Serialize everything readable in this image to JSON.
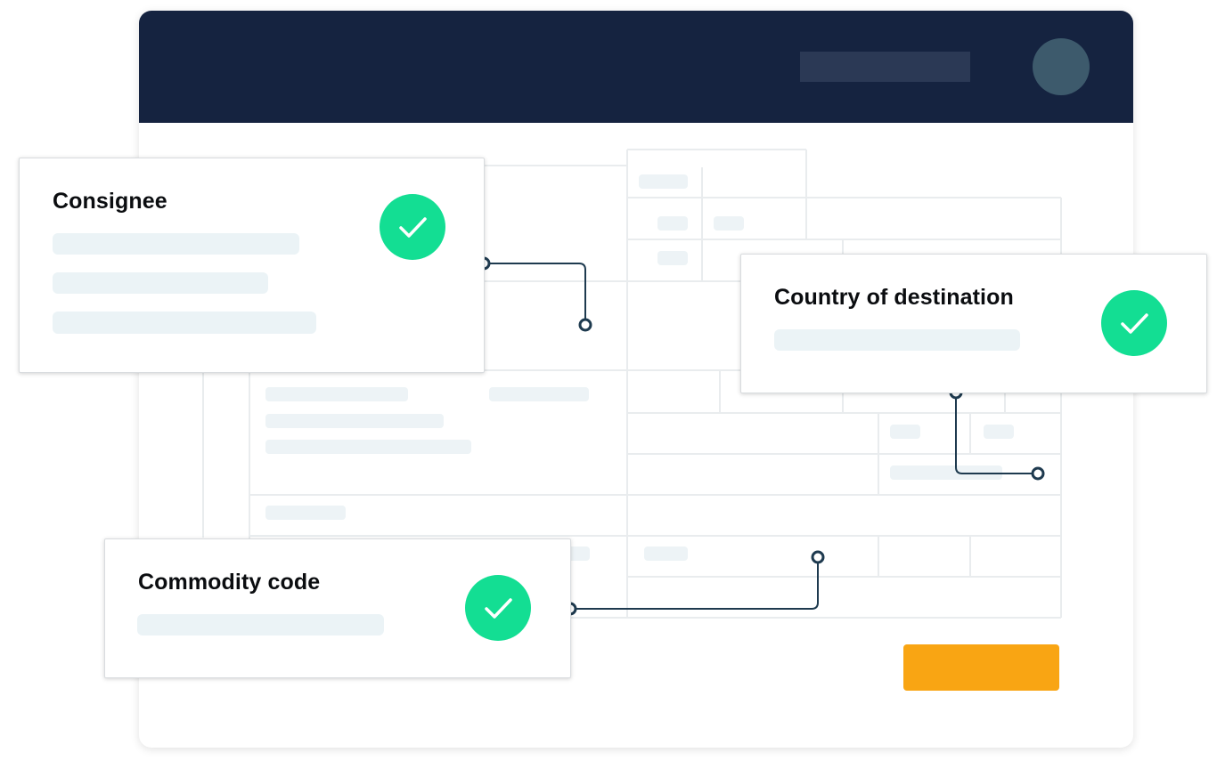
{
  "cards": {
    "consignee": {
      "title": "Consignee",
      "status": "verified"
    },
    "destination": {
      "title": "Country of destination",
      "status": "verified"
    },
    "commodity": {
      "title": "Commodity code",
      "status": "verified"
    }
  },
  "icons": {
    "check": "checkmark-icon",
    "avatar": "avatar-icon"
  },
  "colors": {
    "header": "#152340",
    "accent_button": "#f9a513",
    "success": "#13de93",
    "connector": "#1e3a4f"
  }
}
